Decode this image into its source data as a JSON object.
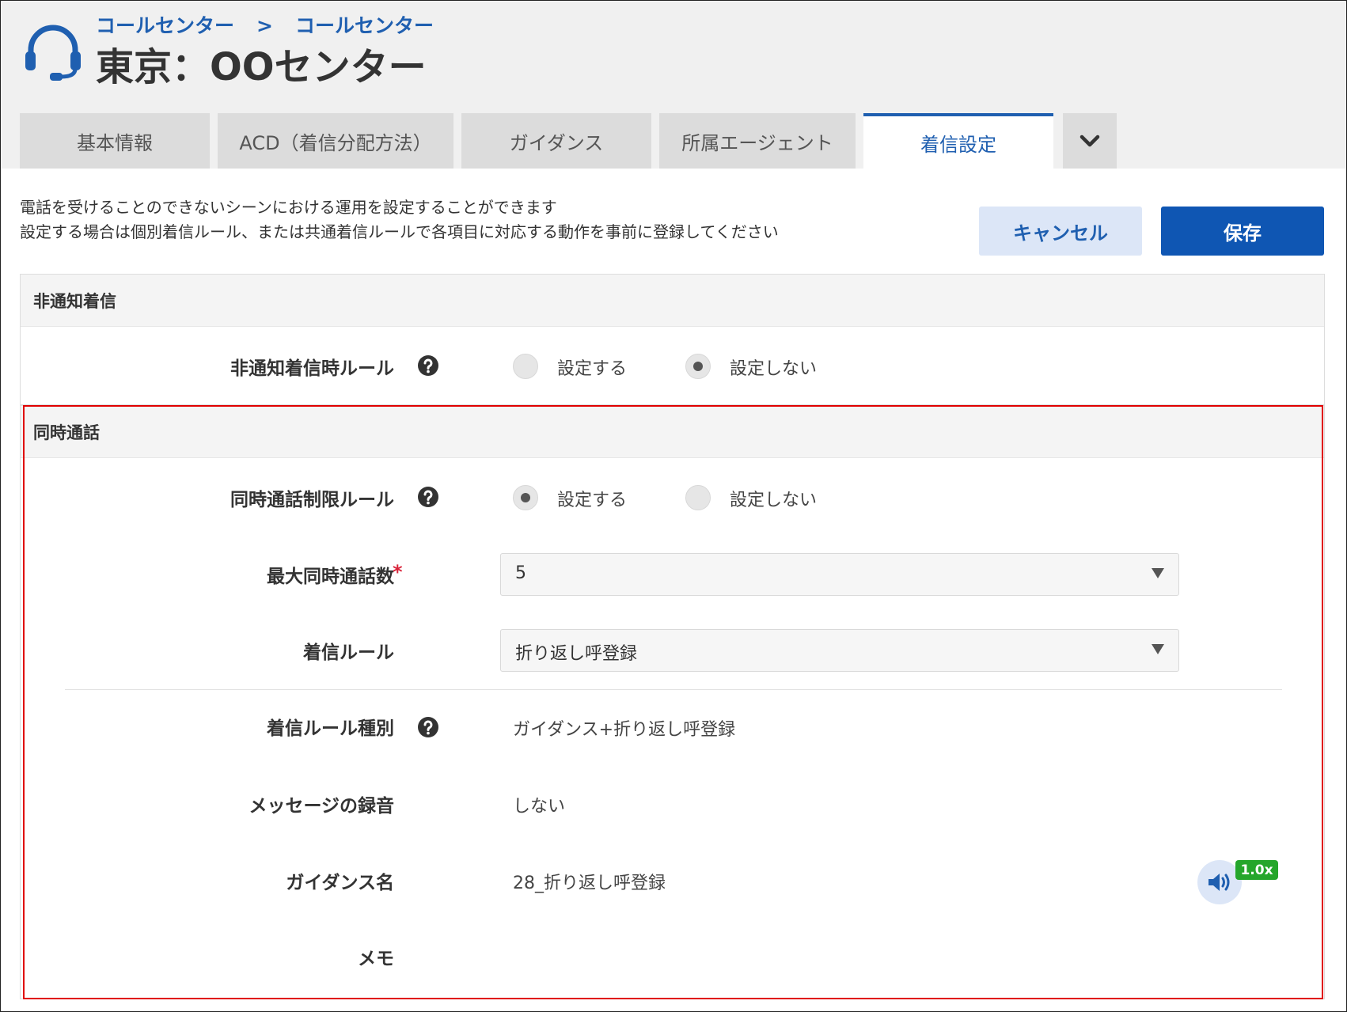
{
  "header": {
    "breadcrumb": [
      "コールセンター",
      "コールセンター"
    ],
    "breadcrumb_separator": ">",
    "title": "東京：OOセンター"
  },
  "tabs": [
    {
      "label": "基本情報",
      "active": false
    },
    {
      "label": "ACD（着信分配方法）",
      "active": false
    },
    {
      "label": "ガイダンス",
      "active": false
    },
    {
      "label": "所属エージェント",
      "active": false
    },
    {
      "label": "着信設定",
      "active": true
    }
  ],
  "description": {
    "line1": "電話を受けることのできないシーンにおける運用を設定することができます",
    "line2": "設定する場合は個別着信ルール、または共通着信ルールで各項目に対応する動作を事前に登録してください"
  },
  "actions": {
    "cancel_label": "キャンセル",
    "save_label": "保存"
  },
  "sections": {
    "anonymous": {
      "title": "非通知着信",
      "rule_label": "非通知着信時ルール",
      "options": [
        "設定する",
        "設定しない"
      ],
      "selected": "設定しない"
    },
    "concurrent": {
      "title": "同時通話",
      "limit_label": "同時通話制限ルール",
      "limit_options": [
        "設定する",
        "設定しない"
      ],
      "limit_selected": "設定する",
      "max_label": "最大同時通話数",
      "required_mark": "*",
      "max_value": "5",
      "rule_label": "着信ルール",
      "rule_value": "折り返し呼登録",
      "type_label": "着信ルール種別",
      "type_value": "ガイダンス+折り返し呼登録",
      "record_label": "メッセージの録音",
      "record_value": "しない",
      "guidance_label": "ガイダンス名",
      "guidance_value": "28_折り返し呼登録",
      "playback_speed": "1.0x",
      "memo_label": "メモ",
      "memo_value": ""
    }
  },
  "colors": {
    "accent": "#1f5fb0",
    "save_button": "#0f56b3",
    "highlight_box": "#e00000",
    "speed_badge": "#25a62b"
  }
}
